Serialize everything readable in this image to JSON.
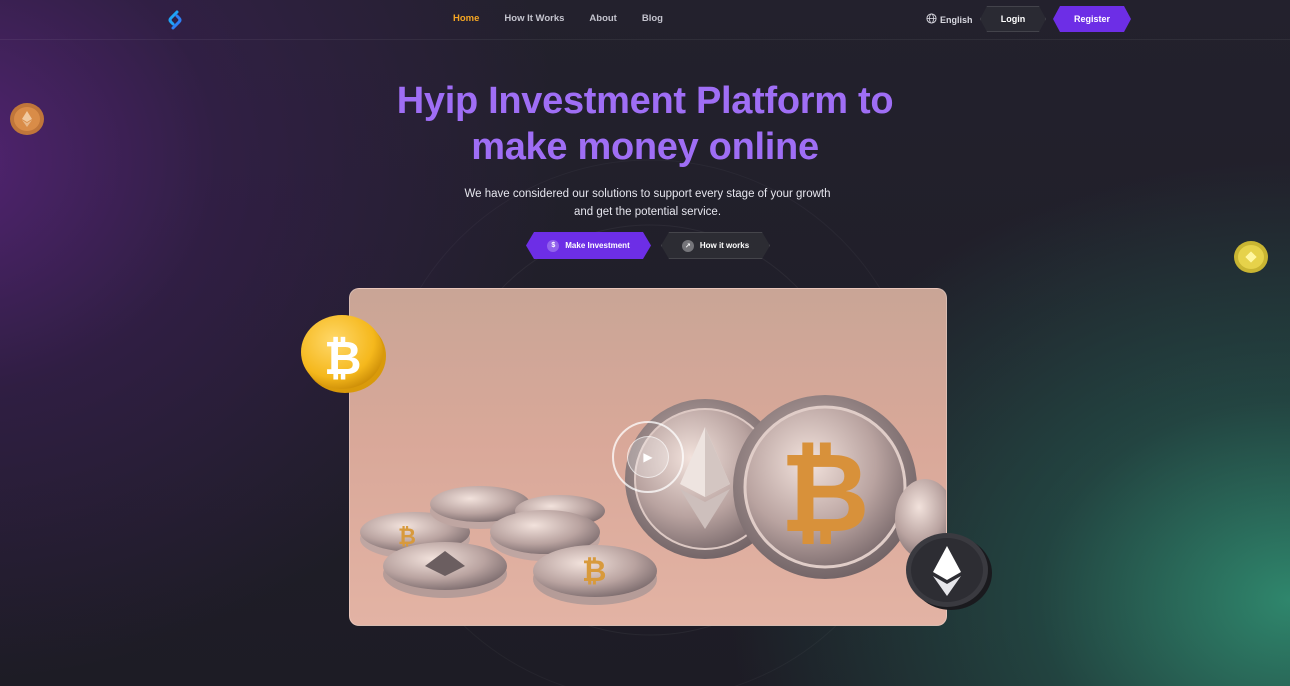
{
  "nav": {
    "links": [
      {
        "label": "Home",
        "active": true
      },
      {
        "label": "How It Works",
        "active": false
      },
      {
        "label": "About",
        "active": false
      },
      {
        "label": "Blog",
        "active": false
      }
    ],
    "language": "English",
    "login_label": "Login",
    "register_label": "Register"
  },
  "hero": {
    "title_line1": "Hyip Investment Platform to",
    "title_line2": "make money online",
    "subtitle_line1": "We have considered our solutions to support every stage of your growth",
    "subtitle_line2": "and get the potential service.",
    "invest_label": "Make Investment",
    "how_label": "How it works"
  },
  "icons": {
    "logo": "logo-icon",
    "language": "globe-icon",
    "invest": "dollar-icon",
    "how": "arrow-up-right-icon",
    "play": "play-icon"
  },
  "colors": {
    "accent_purple": "#6d2ee6",
    "title_purple": "#9f6ef5",
    "active_link": "#f5a623",
    "bitcoin_gold": "#f5b81c"
  }
}
